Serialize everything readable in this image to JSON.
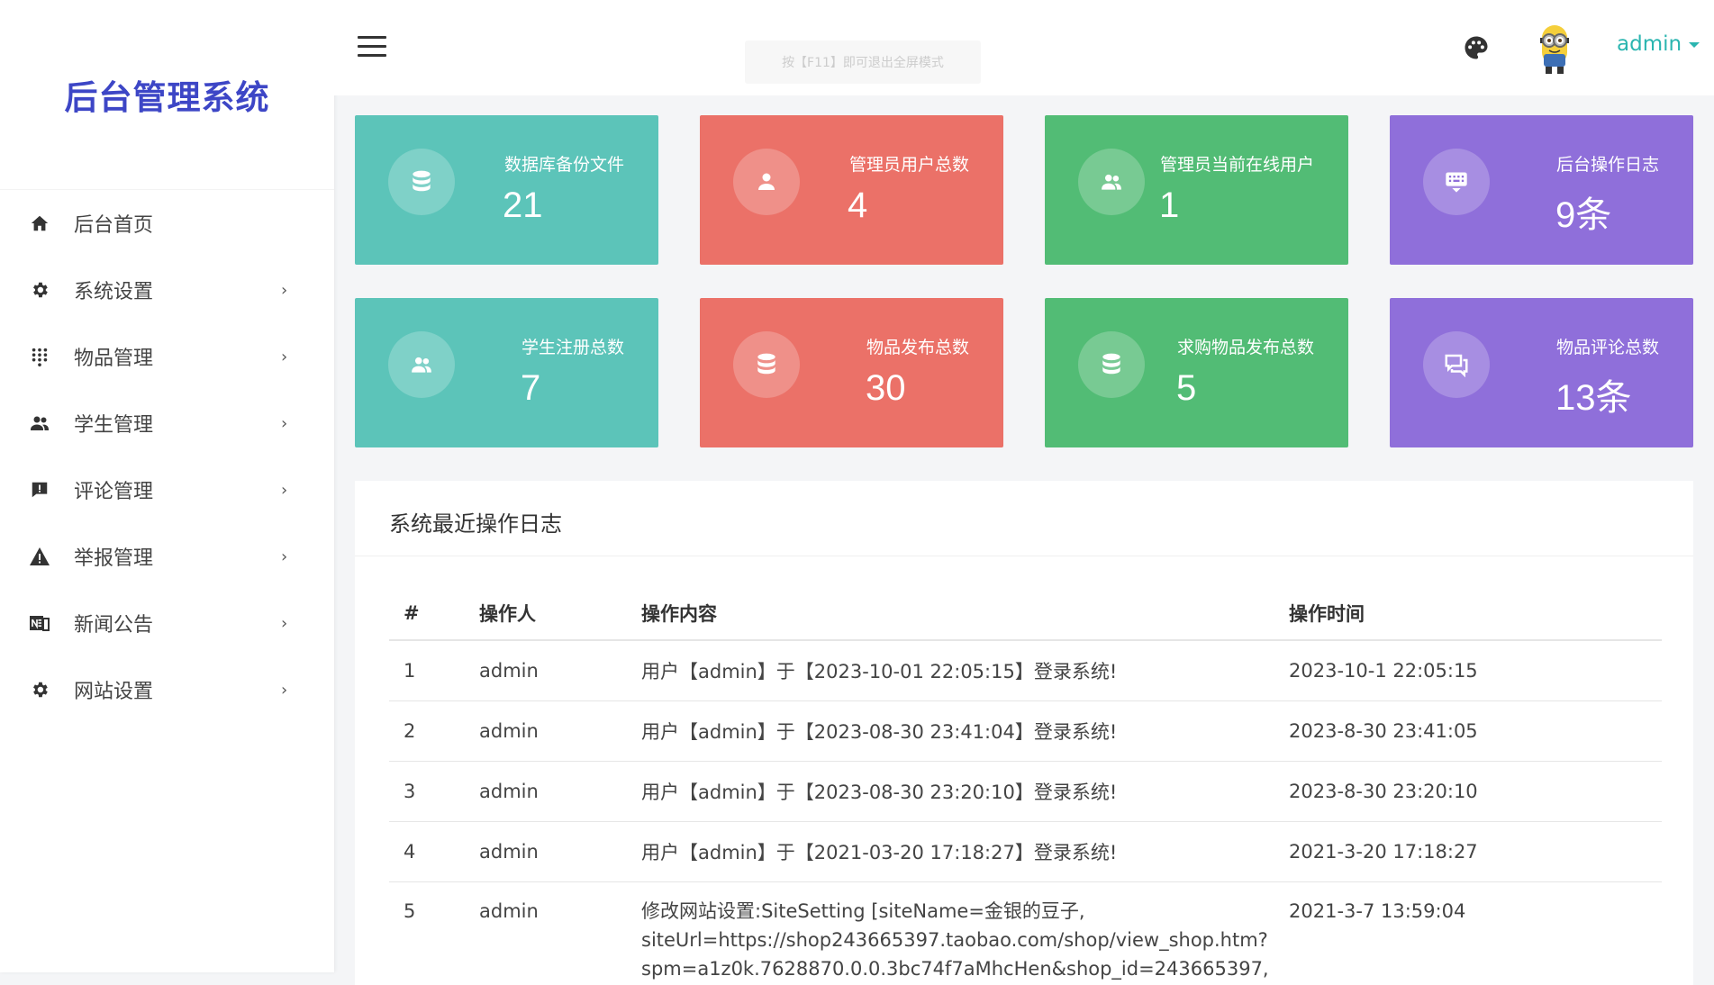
{
  "app": {
    "title": "后台管理系统"
  },
  "sidebar": {
    "items": [
      {
        "label": "后台首页",
        "icon": "home-icon",
        "has_children": false
      },
      {
        "label": "系统设置",
        "icon": "gear-icon",
        "has_children": true
      },
      {
        "label": "物品管理",
        "icon": "grid-dots-icon",
        "has_children": true
      },
      {
        "label": "学生管理",
        "icon": "people-icon",
        "has_children": true
      },
      {
        "label": "评论管理",
        "icon": "comment-alert-icon",
        "has_children": true
      },
      {
        "label": "举报管理",
        "icon": "warning-icon",
        "has_children": true
      },
      {
        "label": "新闻公告",
        "icon": "newspaper-icon",
        "has_children": true
      },
      {
        "label": "网站设置",
        "icon": "gear-icon",
        "has_children": true
      }
    ],
    "chevron": "›"
  },
  "header": {
    "fullscreen_hint": "按【F11】即可退出全屏模式",
    "username": "admin",
    "accent": "#2bb5b0"
  },
  "cards": [
    {
      "title": "数据库备份文件",
      "value": "21",
      "icon": "database-icon",
      "color": "#5cc4b9"
    },
    {
      "title": "管理员用户总数",
      "value": "4",
      "icon": "user-icon",
      "color": "#eb7168"
    },
    {
      "title": "管理员当前在线用户",
      "value": "1",
      "icon": "people-icon",
      "color": "#52bc75"
    },
    {
      "title": "后台操作日志",
      "value": "9条",
      "icon": "keyboard-icon",
      "color": "#8f6fda"
    },
    {
      "title": "学生注册总数",
      "value": "7",
      "icon": "people-icon",
      "color": "#5cc4b9"
    },
    {
      "title": "物品发布总数",
      "value": "30",
      "icon": "database-icon",
      "color": "#eb7168"
    },
    {
      "title": "求购物品发布总数",
      "value": "5",
      "icon": "database-icon",
      "color": "#52bc75"
    },
    {
      "title": "物品评论总数",
      "value": "13条",
      "icon": "chat-icon",
      "color": "#8f6fda"
    }
  ],
  "log": {
    "title": "系统最近操作日志",
    "columns": [
      "#",
      "操作人",
      "操作内容",
      "操作时间"
    ],
    "rows": [
      {
        "num": "1",
        "user": "admin",
        "content": "用户【admin】于【2023-10-01 22:05:15】登录系统!",
        "time": "2023-10-1 22:05:15"
      },
      {
        "num": "2",
        "user": "admin",
        "content": "用户【admin】于【2023-08-30 23:41:04】登录系统!",
        "time": "2023-8-30 23:41:05"
      },
      {
        "num": "3",
        "user": "admin",
        "content": "用户【admin】于【2023-08-30 23:20:10】登录系统!",
        "time": "2023-8-30 23:20:10"
      },
      {
        "num": "4",
        "user": "admin",
        "content": "用户【admin】于【2021-03-20 17:18:27】登录系统!",
        "time": "2021-3-20 17:18:27"
      },
      {
        "num": "5",
        "user": "admin",
        "content_lines": [
          "修改网站设置:SiteSetting [siteName=金银的豆子,",
          "siteUrl=https://shop243665397.taobao.com/shop/view_shop.htm?",
          "spm=a1z0k.7628870.0.0.3bc74f7aMhcHen&shop_id=243665397,"
        ],
        "time": "2021-3-7 13:59:04"
      }
    ]
  }
}
